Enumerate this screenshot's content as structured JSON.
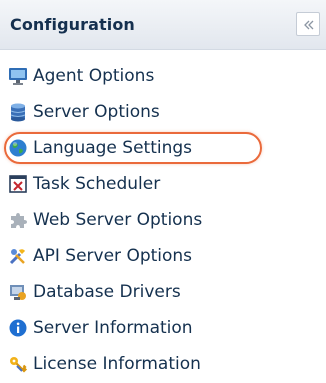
{
  "panel": {
    "title": "Configuration",
    "collapse_icon": "double-chevron-left-icon"
  },
  "items": [
    {
      "label": "Agent Options",
      "icon": "monitor-icon"
    },
    {
      "label": "Server Options",
      "icon": "database-icon"
    },
    {
      "label": "Language Settings",
      "icon": "globe-icon",
      "highlighted": true
    },
    {
      "label": "Task Scheduler",
      "icon": "calendar-icon"
    },
    {
      "label": "Web Server Options",
      "icon": "puzzle-icon"
    },
    {
      "label": "API Server Options",
      "icon": "tools-icon"
    },
    {
      "label": "Database Drivers",
      "icon": "driver-icon"
    },
    {
      "label": "Server Information",
      "icon": "info-icon"
    },
    {
      "label": "License Information",
      "icon": "key-icon"
    }
  ],
  "colors": {
    "header_text": "#15304f",
    "item_text": "#15314f",
    "highlight_ring": "#ea6a3b"
  }
}
